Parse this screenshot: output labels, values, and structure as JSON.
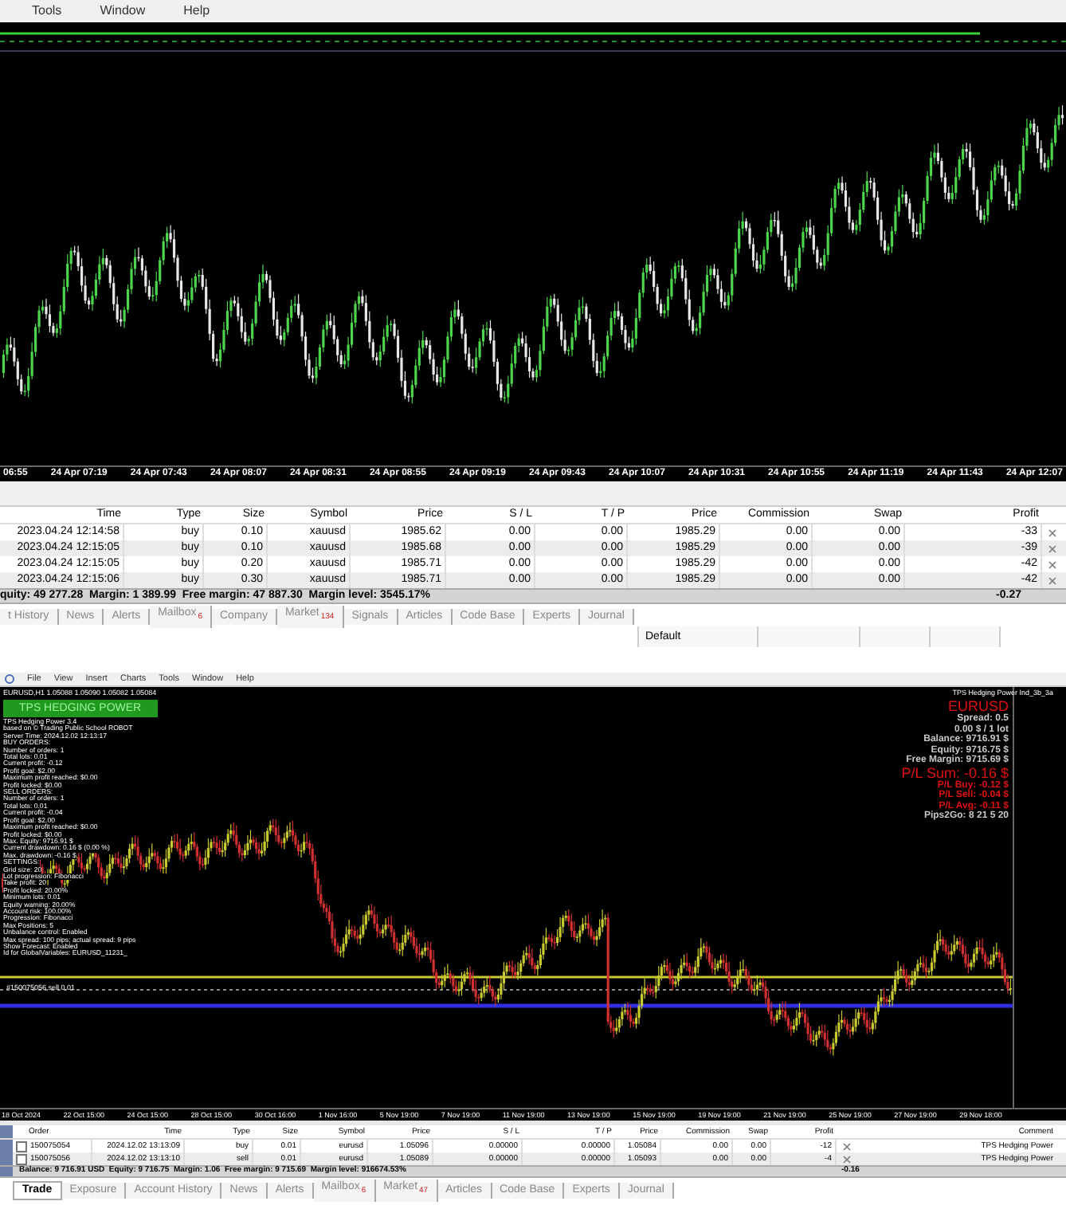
{
  "menu_top": [
    "Tools",
    "Window",
    "Help"
  ],
  "chart_1": {
    "time_labels": [
      "06:55",
      "24 Apr 07:19",
      "24 Apr 07:43",
      "24 Apr 08:07",
      "24 Apr 08:31",
      "24 Apr 08:55",
      "24 Apr 09:19",
      "24 Apr 09:43",
      "24 Apr 10:07",
      "24 Apr 10:31",
      "24 Apr 10:55",
      "24 Apr 11:19",
      "24 Apr 11:43",
      "24 Apr 12:07"
    ]
  },
  "orders_1": {
    "columns": [
      "Time",
      "Type",
      "Size",
      "Symbol",
      "Price",
      "S / L",
      "T / P",
      "Price",
      "Commission",
      "Swap",
      "Profit"
    ],
    "rows": [
      [
        "2023.04.24 12:14:58",
        "buy",
        "0.10",
        "xauusd",
        "1985.62",
        "0.00",
        "0.00",
        "1985.29",
        "0.00",
        "0.00",
        "-33"
      ],
      [
        "2023.04.24 12:15:05",
        "buy",
        "0.10",
        "xauusd",
        "1985.68",
        "0.00",
        "0.00",
        "1985.29",
        "0.00",
        "0.00",
        "-39"
      ],
      [
        "2023.04.24 12:15:05",
        "buy",
        "0.20",
        "xauusd",
        "1985.71",
        "0.00",
        "0.00",
        "1985.29",
        "0.00",
        "0.00",
        "-42"
      ],
      [
        "2023.04.24 12:15:06",
        "buy",
        "0.30",
        "xauusd",
        "1985.71",
        "0.00",
        "0.00",
        "1985.29",
        "0.00",
        "0.00",
        "-42"
      ]
    ],
    "summary": "quity: 49 277.28  Margin: 1 389.99  Free margin: 47 887.30  Margin level: 3545.17%",
    "total_profit": "-0.27"
  },
  "tabs_1": [
    {
      "label": "t History",
      "selected": false
    },
    {
      "label": "News",
      "selected": false
    },
    {
      "label": "Alerts",
      "selected": false
    },
    {
      "label": "Mailbox",
      "badge": "6",
      "selected": false
    },
    {
      "label": "Company",
      "selected": false
    },
    {
      "label": "Market",
      "badge": "134",
      "selected": false
    },
    {
      "label": "Signals",
      "selected": false
    },
    {
      "label": "Articles",
      "selected": false
    },
    {
      "label": "Code Base",
      "selected": false
    },
    {
      "label": "Experts",
      "selected": false
    },
    {
      "label": "Journal",
      "selected": false
    }
  ],
  "panel_header": "Default",
  "menu_2": [
    "File",
    "View",
    "Insert",
    "Charts",
    "Tools",
    "Window",
    "Help"
  ],
  "chart_2": {
    "symbol_info": "EURUSD,H1  1.05088 1.05090 1.05082 1.05084",
    "indicator_name": "TPS Hedging Power Ind_3b_3a",
    "robot_button": "TPS HEDGING POWER",
    "info_lines": [
      "TPS Hedging Power 3.4",
      "based on © Trading Public School ROBOT",
      "Server Time: 2024.12.02 12:13:17",
      "BUY ORDERS:",
      "Number of orders: 1",
      "Total lots: 0.01",
      "Current profit: -0.12",
      "Profit goal: $2.00",
      "Maximum profit reached: $0.00",
      "Profit locked: $0.00",
      "SELL ORDERS:",
      "Number of orders: 1",
      "Total lots: 0.01",
      "Current profit: -0.04",
      "Profit goal: $2.00",
      "Maximum profit reached: $0.00",
      "Profit locked: $0.00",
      "Max. Equity: 9716.91 $",
      "Current drawdown: 0.16 $ (0.00 %)",
      "Max. drawdown: -0.16 $",
      "SETTINGS:",
      "Grid size: 20",
      "Lot progression: Fibonacci",
      "Take profit: 20",
      "Profit locked: 20.00%",
      "Minimum lots: 0.01",
      "Equity warning: 20.00%",
      "Account risk: 100.00%",
      "Progression: Fibonacci",
      "Max Positions: 5",
      "Unbalance control: Enabled",
      "Max spread: 100 pips; actual spread: 9 pips",
      "Show Forecast: Enabled",
      "Id for GlobalVariables: EURUSD_11231_"
    ],
    "stats": [
      {
        "text": "EURUSD",
        "kind": "large",
        "color": "#e01010"
      },
      {
        "text": "Spread: 0.5",
        "kind": "small",
        "color": "#c8c8c8"
      },
      {
        "text": "0.00 $ / 1 lot",
        "kind": "small",
        "color": "#c8c8c8"
      },
      {
        "text": "Balance: 9716.91 $",
        "kind": "small",
        "color": "#c8c8c8"
      },
      {
        "text": "Equity: 9716.75 $",
        "kind": "small",
        "color": "#c8c8c8"
      },
      {
        "text": "Free Margin: 9715.69 $",
        "kind": "small",
        "color": "#c8c8c8"
      },
      {
        "text": "P/L Sum: -0.16 $",
        "kind": "large",
        "color": "#e01010"
      },
      {
        "text": "P/L Buy: -0.12 $",
        "kind": "small",
        "color": "#e01010"
      },
      {
        "text": "P/L Sell: -0.04 $",
        "kind": "small",
        "color": "#e01010"
      },
      {
        "text": "P/L Avg: -0.11 $",
        "kind": "small",
        "color": "#e01010"
      },
      {
        "text": "Pips2Go: 8 21 5 20",
        "kind": "small",
        "color": "#c8c8c8"
      }
    ],
    "order_label": "#150075056 sell 0.01",
    "time_labels": [
      "18 Oct 2024",
      "22 Oct 15:00",
      "24 Oct 15:00",
      "28 Oct 15:00",
      "30 Oct 16:00",
      "1 Nov 16:00",
      "5 Nov 19:00",
      "7 Nov 19:00",
      "11 Nov 19:00",
      "13 Nov 19:00",
      "15 Nov 19:00",
      "19 Nov 19:00",
      "21 Nov 19:00",
      "25 Nov 19:00",
      "27 Nov 19:00",
      "29 Nov 18:00"
    ]
  },
  "orders_2": {
    "columns": [
      "Order",
      "Time",
      "Type",
      "Size",
      "Symbol",
      "Price",
      "S / L",
      "T / P",
      "Price",
      "Commission",
      "Swap",
      "Profit",
      "Comment"
    ],
    "rows": [
      [
        "150075054",
        "2024.12.02 13:13:09",
        "buy",
        "0.01",
        "eurusd",
        "1.05096",
        "0.00000",
        "0.00000",
        "1.05084",
        "0.00",
        "0.00",
        "-12",
        "TPS Hedging Power"
      ],
      [
        "150075056",
        "2024.12.02 13:13:10",
        "sell",
        "0.01",
        "eurusd",
        "1.05089",
        "0.00000",
        "0.00000",
        "1.05093",
        "0.00",
        "0.00",
        "-4",
        "TPS Hedging Power"
      ]
    ],
    "summary": "Balance: 9 716.91 USD  Equity: 9 716.75  Margin: 1.06  Free margin: 9 715.69  Margin level: 916674.53%",
    "total_profit": "-0.16"
  },
  "tabs_2": [
    {
      "label": "Trade",
      "selected": true
    },
    {
      "label": "Exposure",
      "selected": false
    },
    {
      "label": "Account History",
      "selected": false
    },
    {
      "label": "News",
      "selected": false
    },
    {
      "label": "Alerts",
      "selected": false
    },
    {
      "label": "Mailbox",
      "badge": "6",
      "selected": false
    },
    {
      "label": "Market",
      "badge": "47",
      "selected": false
    },
    {
      "label": "Articles",
      "selected": false
    },
    {
      "label": "Code Base",
      "selected": false
    },
    {
      "label": "Experts",
      "selected": false
    },
    {
      "label": "Journal",
      "selected": false
    }
  ]
}
